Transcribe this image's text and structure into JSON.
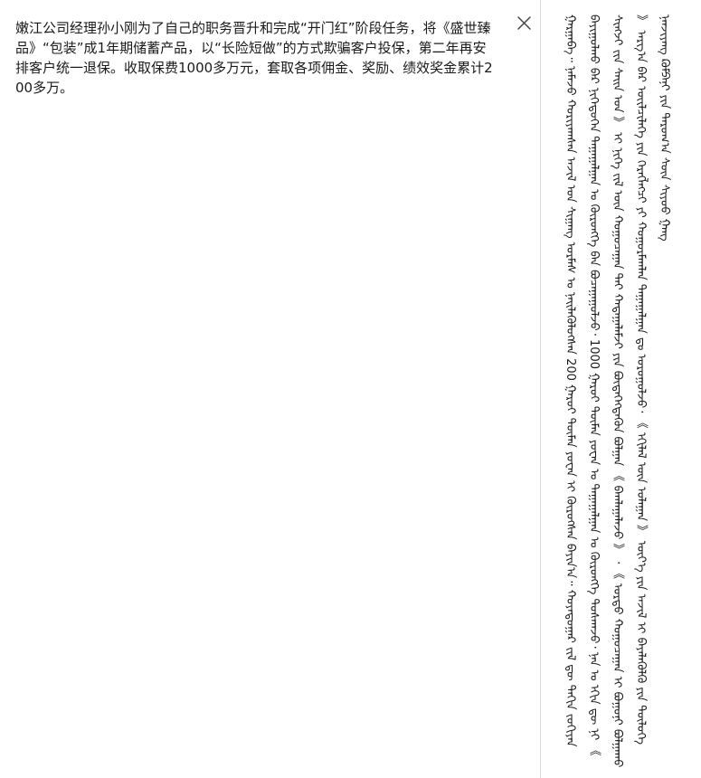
{
  "source_text": "嫩江公司经理孙小刚为了自己的职务晋升和完成“开门红”阶段任务，将《盛世臻品》“包装”成1年期储蓄产品，以“长险短做”的方式欺骗客户投保，第二年再安排客户统一退保。收取保费1000多万元，套取各项佣金、奖励、绩效奖金累计200多万。",
  "translation_text": "ᠭᠠᠷᠭᠠᠪᠠ᠃ ᠨᠡᠮᠡᠵᠦ ᠬᠤᠷᠢᠶᠠᠭᠰᠠᠨ ᠠᠵᠢᠯ ᠤᠨ ᠰᠢᠭᠠᠩ ᠤᠷᠮᠠᠰ ᠤ ᠨᠡᠢᠯᠡᠭᠦᠯᠦᠭᠰᠡᠨ 200 ᠭᠠᠷᠤᠢ ᠲᠦᠮᠡᠨ ᠶᠤᠸᠠᠨ ᠢ ᠬᠦᠷᠦᠭᠰᠡᠨ ᠪᠠᠶᠢᠨ᠎ᠠ᠃ ᠬᠣᠶᠠᠳᠤᠭᠠᠷ ᠵᠢᠯ ᠳᠦ ᠳᠠᠬᠢᠨ ᠵᠣᠬᠢᠶᠠᠨ ᠪᠠᠶᠢᠭᠤᠯᠬᠤ ᠪᠠᠷ ᠨᠢᠭᠡᠳᠦᠭᠡᠨ ᠳᠠᠭᠠᠭᠠᠯᠭᠠᠨ ᠤ ᠬᠥᠷᠥᠩᠭᠡ ᠪᠡᠨ ᠪᠤᠴᠠᠭᠠᠭᠤᠯᠵᠤ᠂ 1000 ᠭᠠᠷᠤᠢ ᠲᠦᠮᠡᠨ ᠶᠤᠸᠠᠨ ᠤ ᠳᠠᠭᠠᠭᠠᠯᠭᠠᠨ ᠤ ᠬᠥᠷᠥᠩᠭᠡ ᠲᠤᠰᠬᠠᠵᠤ᠂ ᠨᠡᠨ ᠤ ᠡᠬᠢᠨ ᠳᠦ ᠨᠢ 《 ᠰᠢᠩᠵᠢ ᠵᠢᠨ ᠰᠠᠢᠨ ᠡᠳ 》 ᠢ ᠨᠢᠭᠡ ᠵᠢᠯ ᠦᠨ ᠬᠤᠭᠤᠴᠠᠭᠠᠨ ᠲᠠᠢ ᠬᠠᠳᠠᠭᠠᠯᠠᠮᠵᠢ ᠶᠢᠨ ᠪᠦᠲᠡᠭᠡᠭᠳᠡᠬᠦᠨ ᠪᠣᠯᠭᠠᠨ 《 ᠪᠠᠭᠯᠠᠭᠠᠯᠠᠵᠤ 》 ᠂ 《 ᠤᠷᠲᠤ ᠬᠤᠭᠤᠴᠠᠭᠠᠨ ᠢ ᠪᠣᠭᠤᠨᠢ ᠪᠣᠯᠭᠠᠬᠤ 》 ᠠᠷᠭ᠎ᠠ ᠪᠠᠷ ᠦᠢᠯᠴᠢᠯᠡᠭᠡ ᠶᠢᠨ ᠬᠡᠷᠡᠭᠯᠡᠭᠴᠢ ᠶᠢ ᠬᠤᠭᠤᠷᠮᠠᠭᠯᠠᠨ ᠳᠠᠭᠠᠭᠠᠯᠭᠠᠨ ᠳᠤ ᠣᠷᠤᠭᠤᠯᠵᠤ᠂ 《 ᠡᠬᠢᠯᠡᠯ ᠦᠨ ᠤᠯᠠᠭᠠᠨ 》 ᠦᠶ᠎ᠡ ᠶᠢᠨ ᠠᠵᠢᠯ ᠢ ᠪᠡᠶᠡᠯᠡᠭᠦᠯᠬᠦ ᠶᠢᠨ ᠲᠥᠯᠥᠭᠡ ᠨᠡᠨᠵᠢᠶᠠᠩ ᠺᠣᠮᠫᠠᠨᠢ ᠶᠢᠨ ᠳᠠᠷᠤᠭ᠎ᠠ ᠰᠦᠨ ᠰᠢᠶᠣᠤ ᠭᠠᠩ",
  "icons": {
    "close": "close-icon"
  },
  "colors": {
    "text": "#1a1a1a",
    "divider": "#d9d9d9",
    "close_icon": "#444444"
  }
}
